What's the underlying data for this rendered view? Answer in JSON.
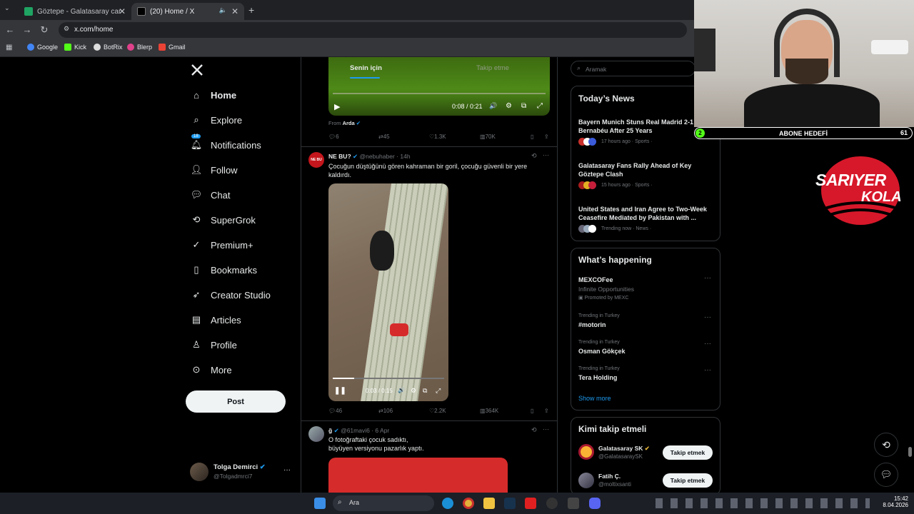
{
  "browser": {
    "tabs": [
      {
        "title": "Göztepe - Galatasaray canlı skor",
        "close": "✕"
      },
      {
        "title": "(20) Home / X",
        "close": "✕"
      }
    ],
    "new_tab": "+",
    "url": "x.com/home",
    "bookmarks": [
      "Google",
      "Kick",
      "BotRix",
      "Blerp",
      "Gmail"
    ]
  },
  "sidebar": {
    "items": [
      {
        "label": "Home",
        "icon": "home-icon"
      },
      {
        "label": "Explore",
        "icon": "search-icon"
      },
      {
        "label": "Notifications",
        "icon": "bell-icon",
        "badge": "18"
      },
      {
        "label": "Follow",
        "icon": "person-add-icon"
      },
      {
        "label": "Chat",
        "icon": "chat-icon"
      },
      {
        "label": "SuperGrok",
        "icon": "grok-icon"
      },
      {
        "label": "Premium+",
        "icon": "verified-icon"
      },
      {
        "label": "Bookmarks",
        "icon": "bookmark-icon"
      },
      {
        "label": "Creator Studio",
        "icon": "rocket-icon"
      },
      {
        "label": "Articles",
        "icon": "article-icon"
      },
      {
        "label": "Profile",
        "icon": "person-icon"
      },
      {
        "label": "More",
        "icon": "more-circle-icon"
      }
    ],
    "post_label": "Post",
    "account": {
      "name": "Tolga Demirci",
      "handle": "@Tolgadmrci7",
      "more": "···"
    }
  },
  "feed": {
    "top_tabs": [
      "Senin için",
      "Takip etme"
    ],
    "video1": {
      "time": "0:08 / 0:21",
      "from_label": "From",
      "from_name": "Arda"
    },
    "post1_actions": {
      "replies": "6",
      "reposts": "45",
      "likes": "1.3K",
      "views": "70K"
    },
    "post2": {
      "avatar_text": "NE BU",
      "name": "NE BU?",
      "handle": "@nebuhaber",
      "time": "· 14h",
      "text": "Çocuğun düştüğünü gören kahraman bir goril, çocuğu güvenli bir yere kaldırdı.",
      "video_time": "0:03 / 0:15",
      "replies": "46",
      "reposts": "106",
      "likes": "2.2K",
      "views": "364K",
      "more": "···"
    },
    "post3": {
      "name": "ğ",
      "handle": "@61mavi6",
      "time": "· 6 Apr",
      "text_line1": "O fotoğraftaki çocuk sadıktı,",
      "text_line2": "büyüyen versiyonu pazarlık yaptı.",
      "more": "···"
    }
  },
  "right": {
    "search_placeholder": "Aramak",
    "news_title": "Today’s News",
    "news": [
      {
        "title": "Bayern Munich Stuns Real Madrid 2-1 at Bernabéu After 25 Years",
        "meta": "17 hours ago · Sports ·"
      },
      {
        "title": "Galatasaray Fans Rally Ahead of Key Göztepe Clash",
        "meta": "15 hours ago · Sports ·"
      },
      {
        "title": "United States and Iran Agree to Two-Week Ceasefire Mediated by Pakistan with ...",
        "meta": "Trending now · News ·"
      }
    ],
    "happening_title": "What’s happening",
    "promo": {
      "name": "MEXCOFee",
      "sub": "Infinite Opportunities",
      "promoted": "Promoted by MEXC"
    },
    "trends": [
      {
        "context": "Trending in Turkey",
        "name": "#motorin"
      },
      {
        "context": "Trending in Turkey",
        "name": "Osman Gökçek"
      },
      {
        "context": "Trending in Turkey",
        "name": "Tera Holding"
      }
    ],
    "show_more": "Show more",
    "who_title": "Kimi takip etmeli",
    "who": [
      {
        "name": "Galatasaray SK",
        "handle": "@GalatasaraySK",
        "button": "Takip etmek"
      },
      {
        "name": "Fatih Ç.",
        "handle": "@moltixsanti",
        "button": "Takip etmek"
      }
    ]
  },
  "overlay": {
    "goal_left": "2",
    "goal_label": "ABONE HEDEFİ",
    "goal_right": "61",
    "logo_line1": "SARIYER",
    "logo_line2": "KOLA"
  },
  "taskbar": {
    "search": "Ara",
    "time": "15:42",
    "date": "8.04.2026"
  },
  "colors": {
    "accent": "#1d9bf0",
    "bg": "#000000",
    "text": "#e7e9ea",
    "muted": "#71767b",
    "logo_red": "#d7182a"
  }
}
